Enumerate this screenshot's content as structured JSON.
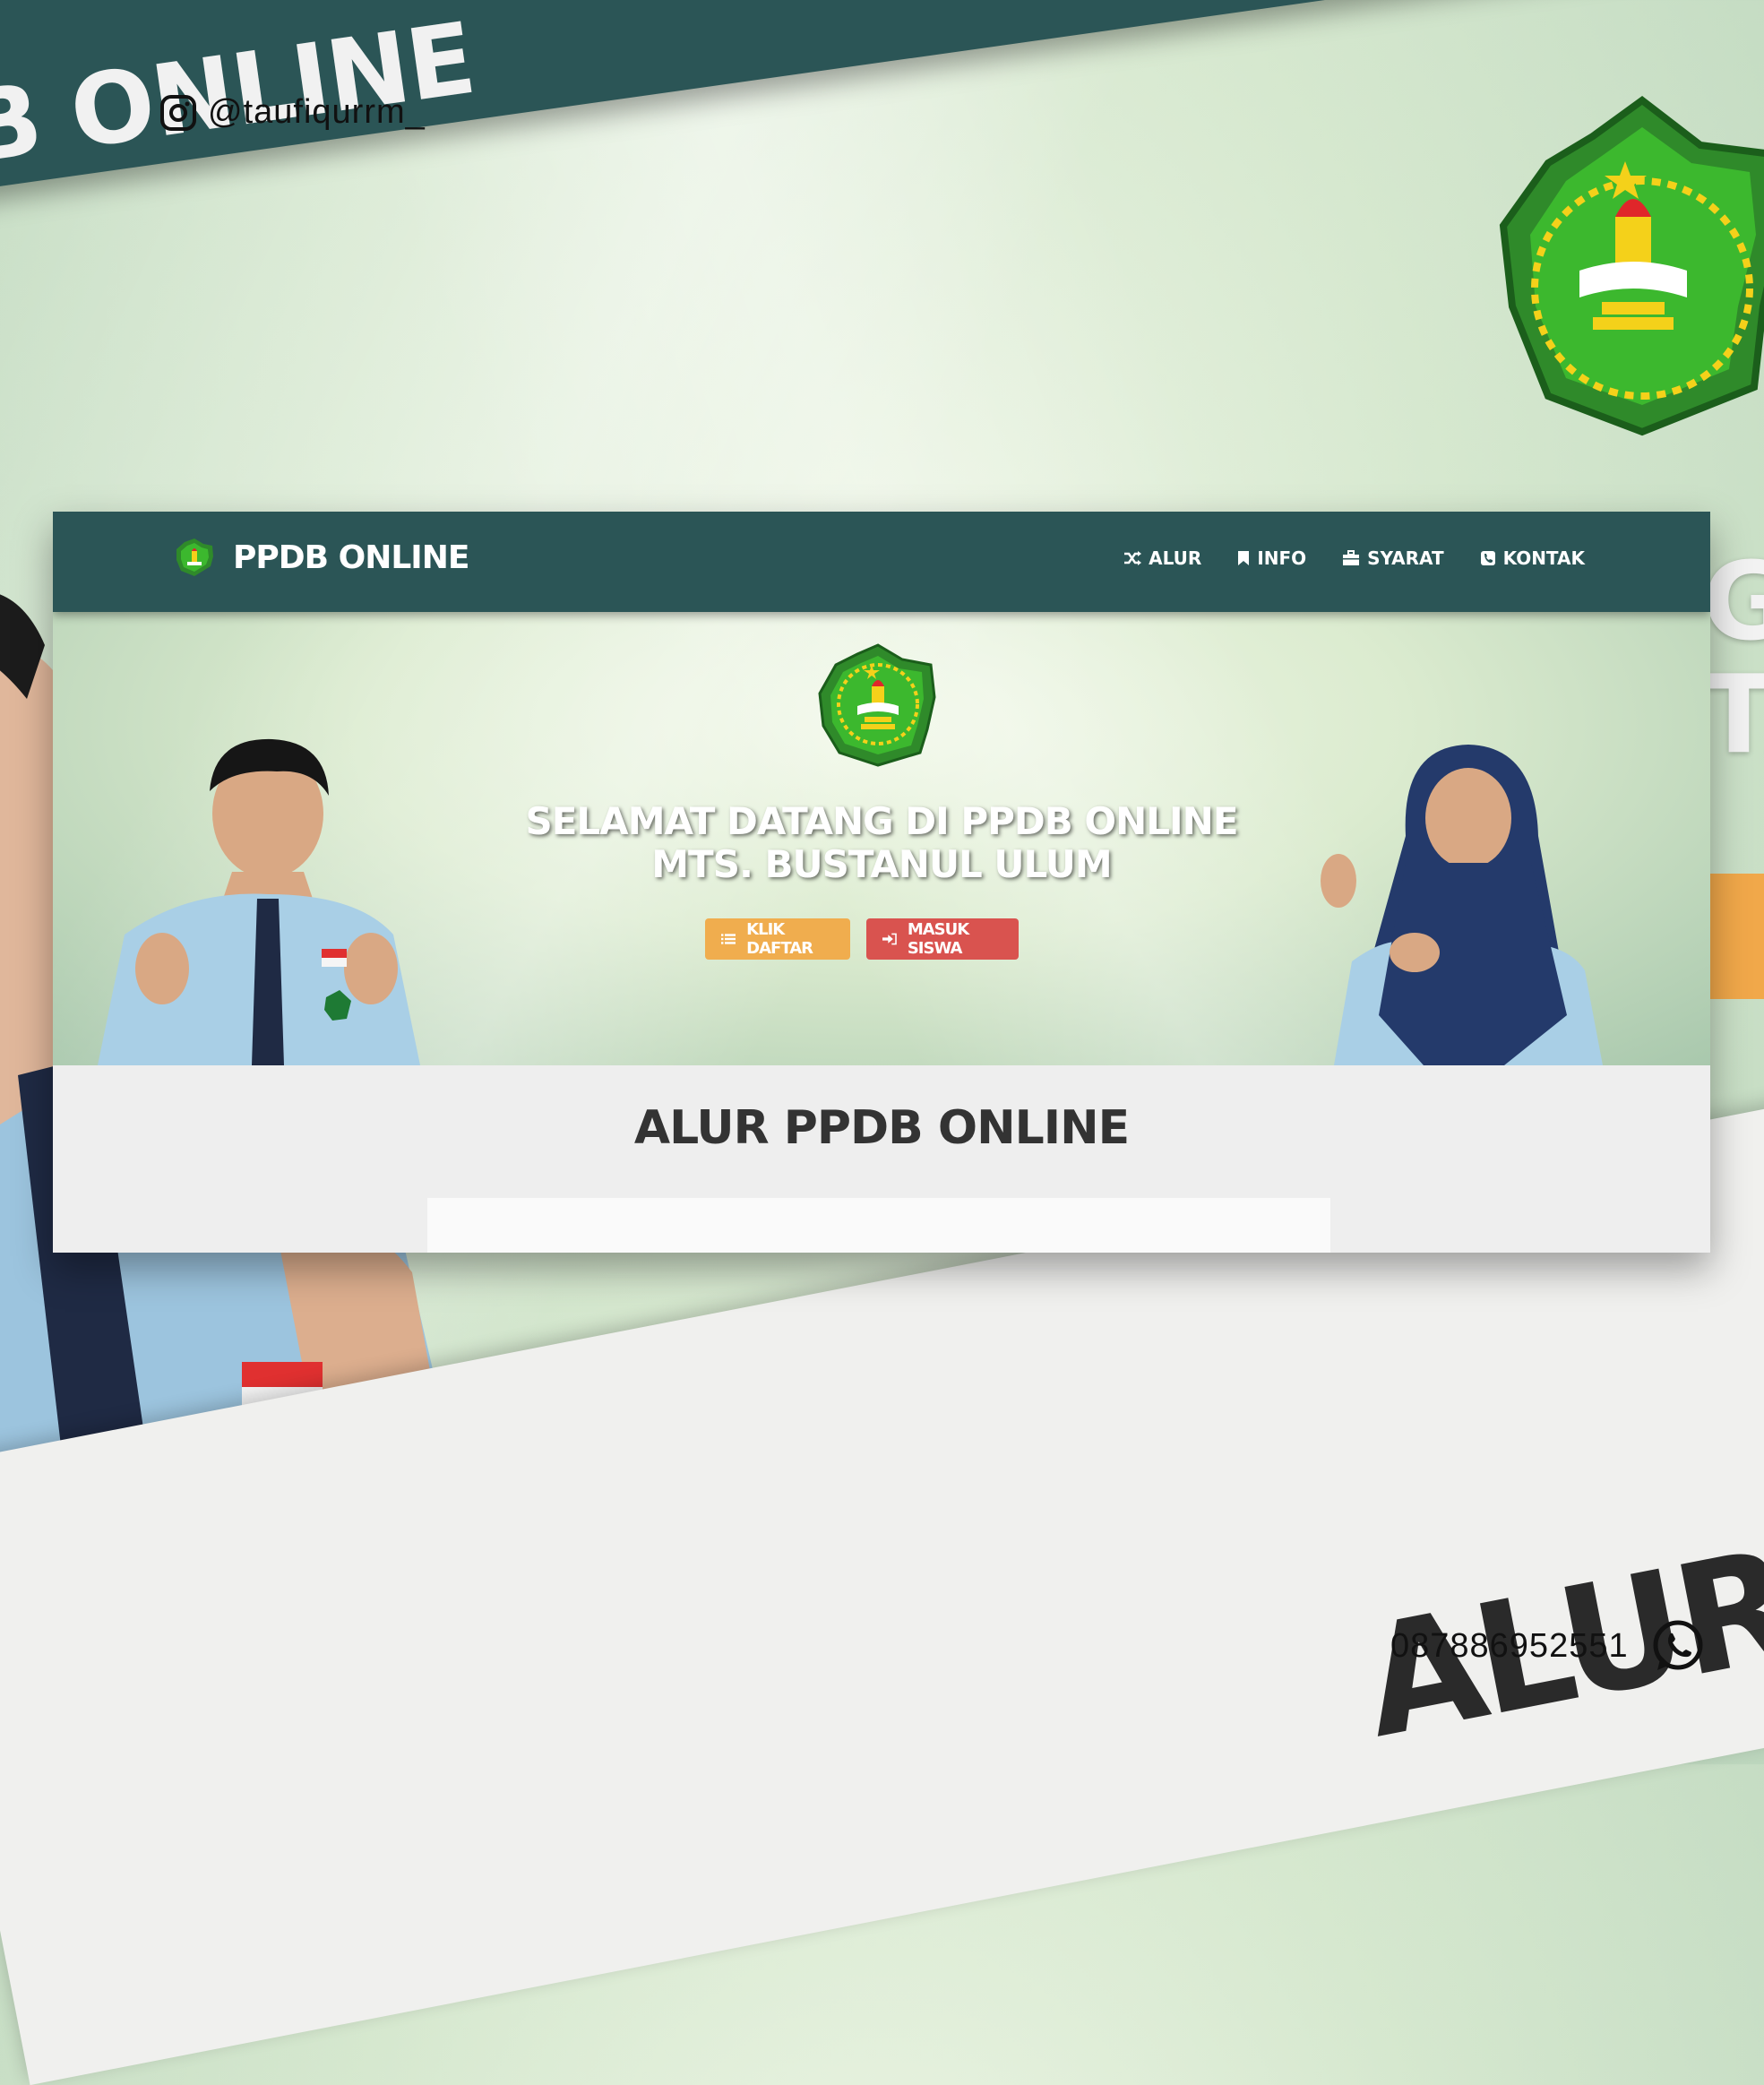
{
  "background": {
    "banner_text": "B ONLINE",
    "bottom_text": "ALUR P",
    "right_text": "G\nTA"
  },
  "social": {
    "instagram_handle": "@taufiqurrm_",
    "whatsapp_number": "087886952551"
  },
  "navbar": {
    "brand": "PPDB ONLINE",
    "items": [
      {
        "label": "ALUR",
        "icon": "shuffle-icon"
      },
      {
        "label": "INFO",
        "icon": "bookmark-icon"
      },
      {
        "label": "SYARAT",
        "icon": "briefcase-icon"
      },
      {
        "label": "KONTAK",
        "icon": "phone-icon"
      }
    ]
  },
  "hero": {
    "title_line1": "SELAMAT DATANG DI PPDB ONLINE",
    "title_line2": "MTS. BUSTANUL ULUM",
    "btn_daftar": "KLIK DAFTAR",
    "btn_masuk": "MASUK SISWA"
  },
  "section": {
    "title": "ALUR PPDB ONLINE"
  },
  "colors": {
    "navbar": "#2b5556",
    "btn_daftar": "#f0ad4e",
    "btn_masuk": "#d9534f",
    "logo_green": "#3aa02a"
  }
}
